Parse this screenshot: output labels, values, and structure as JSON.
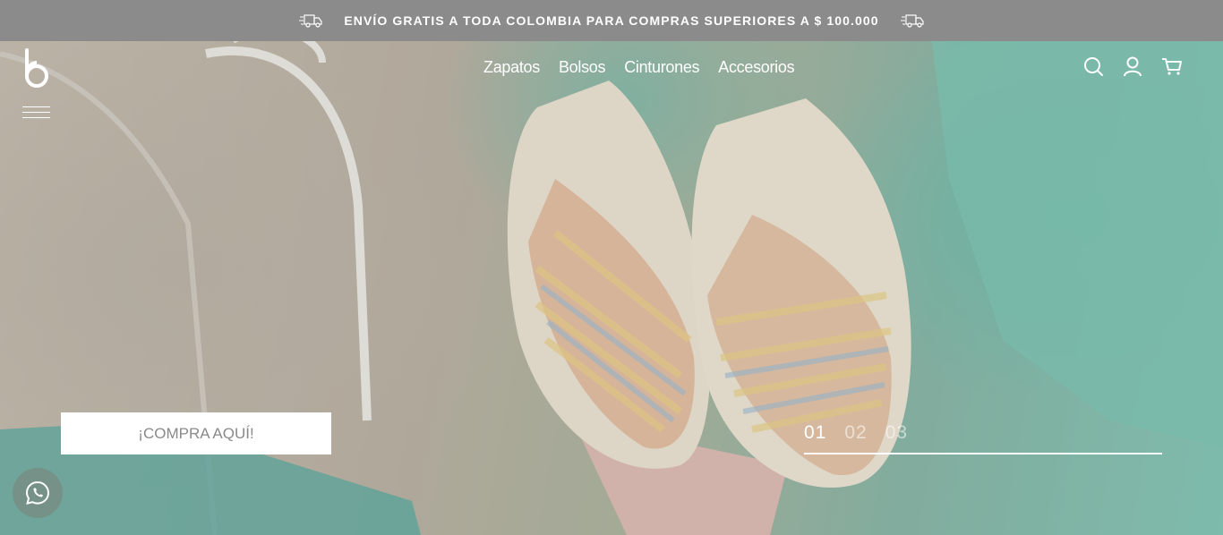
{
  "announcement": {
    "text": "ENVÍO GRATIS A TODA COLOMBIA PARA COMPRAS SUPERIORES A $ 100.000",
    "icon": "truck-icon"
  },
  "brand": {
    "logo_icon": "b-logo-icon"
  },
  "nav": {
    "items": [
      {
        "label": "Zapatos"
      },
      {
        "label": "Bolsos"
      },
      {
        "label": "Cinturones"
      },
      {
        "label": "Accesorios"
      }
    ]
  },
  "header_icons": [
    "search-icon",
    "account-icon",
    "cart-icon"
  ],
  "hero": {
    "cta_label": "¡COMPRA AQUÍ!",
    "slides": [
      "01",
      "02",
      "03"
    ],
    "active_slide": "01"
  },
  "colors": {
    "topbar": "#8b8b8b",
    "accent_teal": "#57b49d",
    "white": "#ffffff"
  },
  "whatsapp": {
    "icon": "whatsapp-icon"
  }
}
